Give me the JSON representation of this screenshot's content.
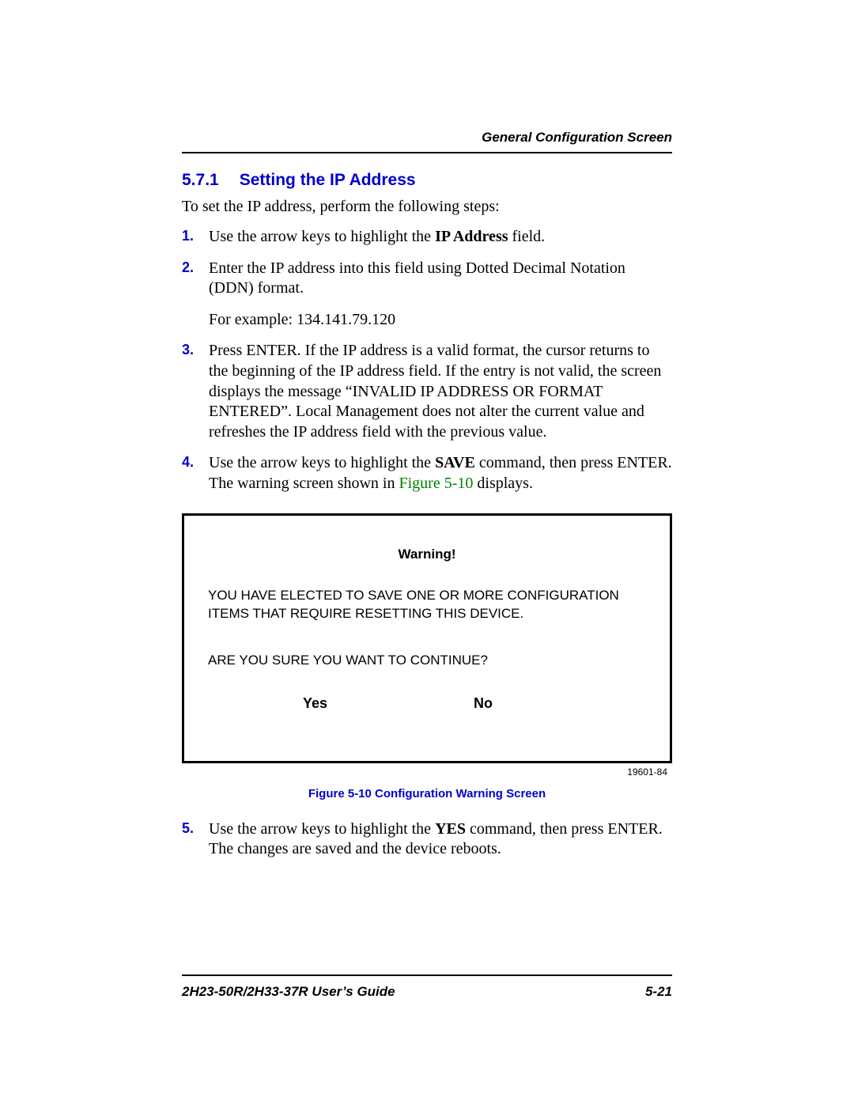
{
  "header": {
    "region": "General Configuration Screen"
  },
  "section": {
    "number": "5.7.1",
    "title": "Setting the IP Address",
    "intro": "To set the IP address, perform the following steps:"
  },
  "steps": [
    {
      "marker": "1.",
      "pre": "Use the arrow keys to highlight the ",
      "bold": "IP Address",
      "post": " field."
    },
    {
      "marker": "2.",
      "text": "Enter the IP address into this field using Dotted Decimal Notation (DDN) format.",
      "extra": "For example: 134.141.79.120"
    },
    {
      "marker": "3.",
      "text": "Press ENTER. If the IP address is a valid format, the cursor returns to the beginning of the IP address field. If the entry is not valid, the screen displays the message “INVALID IP ADDRESS OR FORMAT ENTERED”. Local Management does not alter the current value and refreshes the IP address field with the previous value."
    },
    {
      "marker": "4.",
      "pre": "Use the arrow keys to highlight the ",
      "bold": "SAVE",
      "post": " command, then press ENTER. The warning screen shown in ",
      "figref": "Figure 5-10",
      "tail": " displays."
    },
    {
      "marker": "5.",
      "pre": "Use the arrow keys to highlight the ",
      "bold": "YES",
      "post": " command, then press ENTER. The changes are saved and the device reboots."
    }
  ],
  "figure": {
    "warning_title": "Warning!",
    "body": "YOU HAVE ELECTED TO SAVE ONE OR MORE CONFIGURATION ITEMS THAT REQUIRE RESETTING THIS DEVICE.",
    "question": "ARE YOU SURE YOU WANT TO CONTINUE?",
    "yes": "Yes",
    "no": "No",
    "code": "19601-84",
    "caption": "Figure 5-10    Configuration Warning Screen"
  },
  "footer": {
    "guide": "2H23-50R/2H33-37R User’s Guide",
    "page": "5-21"
  }
}
